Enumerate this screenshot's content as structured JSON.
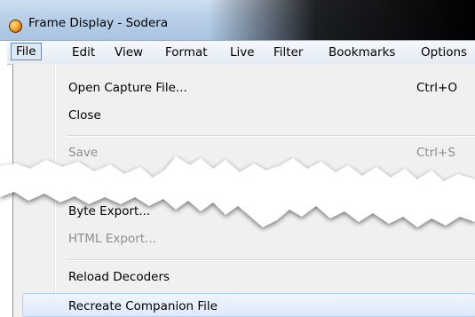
{
  "window": {
    "title": "Frame Display - Sodera",
    "app_icon": "sodera-app-icon"
  },
  "menubar": {
    "items": [
      "File",
      "Edit",
      "View",
      "Format",
      "Live",
      "Filter",
      "Bookmarks",
      "Options"
    ],
    "active": "File"
  },
  "file_menu": {
    "items": [
      {
        "label": "Open Capture File...",
        "shortcut": "Ctrl+O",
        "enabled": true
      },
      {
        "label": "Close",
        "shortcut": "",
        "enabled": true
      },
      {
        "label": "Save",
        "shortcut": "Ctrl+S",
        "enabled": false
      },
      {
        "label": "Byte Export...",
        "shortcut": "",
        "enabled": true
      },
      {
        "label": "HTML Export...",
        "shortcut": "",
        "enabled": false
      },
      {
        "label": "Reload Decoders",
        "shortcut": "",
        "enabled": true
      },
      {
        "label": "Recreate Companion File",
        "shortcut": "",
        "enabled": true,
        "hovered": true
      }
    ]
  },
  "colors": {
    "menu_background": "#f0f0f0",
    "disabled_text": "#8d8d8d",
    "hover_border": "#aecff7",
    "titlebar": "#b9d0e8"
  }
}
